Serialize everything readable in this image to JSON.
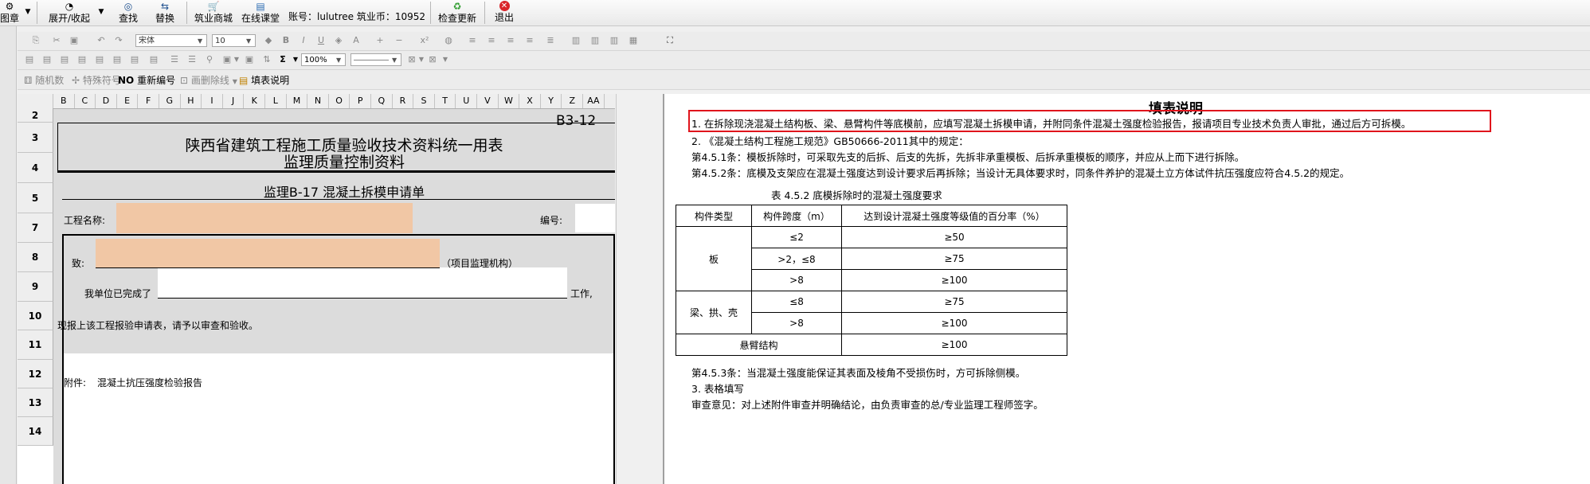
{
  "toolbar": {
    "items": [
      {
        "label": "图章",
        "icon": "stamp-icon"
      },
      {
        "label": "展开/收起",
        "icon": "expand-collapse-icon"
      },
      {
        "label": "查找",
        "icon": "binoculars-icon"
      },
      {
        "label": "替换",
        "icon": "replace-icon"
      },
      {
        "label": "筑业商城",
        "icon": "shopping-cart-icon"
      },
      {
        "label": "在线课堂",
        "icon": "book-icon"
      },
      {
        "label": "检查更新",
        "icon": "update-icon"
      },
      {
        "label": "退出",
        "icon": "exit-icon"
      }
    ],
    "account_text": "账号：lulutree 筑业币：10952"
  },
  "format_bar": {
    "font_name": "宋体",
    "font_size": "10",
    "zoom": "100%"
  },
  "sub_toolbar": {
    "random_number": "随机数",
    "special_symbol": "特殊符号",
    "renumber": "重新编号",
    "delete_line": "画删除线",
    "fill_instructions": "填表说明"
  },
  "sheet": {
    "columns": [
      "B",
      "C",
      "D",
      "E",
      "F",
      "G",
      "H",
      "I",
      "J",
      "K",
      "L",
      "M",
      "N",
      "O",
      "P",
      "Q",
      "R",
      "S",
      "T",
      "U",
      "V",
      "W",
      "X",
      "Y",
      "Z",
      "AA"
    ],
    "rows": [
      "2",
      "3",
      "4",
      "5",
      "7",
      "8",
      "9",
      "10",
      "11",
      "12",
      "13",
      "14"
    ],
    "code": "B3-12",
    "title_line1": "陕西省建筑工程施工质量验收技术资料统一用表",
    "title_line2": "监理质量控制资料",
    "form_title": "监理B-17  混凝土拆模申请单",
    "project_name_label": "工程名称:",
    "number_label": "编号:",
    "to_label": "致:",
    "supervisor_org": "（项目监理机构）",
    "completed_prefix": "我单位已完成了",
    "work_suffix": "工作,",
    "submit_text": "现报上该工程报验申请表，请予以审查和验收。",
    "attachment_label": "附件:",
    "attachment_text": "混凝土抗压强度检验报告"
  },
  "instructions": {
    "heading": "填表说明",
    "line1": "1. 在拆除现浇混凝土结构板、梁、悬臂构件等底模前，应填写混凝土拆模申请，并附同条件混凝土强度检验报告，报请项目专业技术负责人审批，通过后方可拆模。",
    "line2": "2. 《混凝土结构工程施工规范》GB50666-2011其中的规定：",
    "line3": "第4.5.1条：模板拆除时，可采取先支的后拆、后支的先拆，先拆非承重模板、后拆承重模板的顺序，并应从上而下进行拆除。",
    "line4": "第4.5.2条：底模及支架应在混凝土强度达到设计要求后再拆除；当设计无具体要求时，同条件养护的混凝土立方体试件抗压强度应符合4.5.2的规定。",
    "table_caption": "表 4.5.2  底模拆除时的混凝土强度要求",
    "table_headers": [
      "构件类型",
      "构件跨度（m）",
      "达到设计混凝土强度等级值的百分率（%）"
    ],
    "table_rows": [
      {
        "type": "板",
        "span": "≤2",
        "pct": "≥50"
      },
      {
        "type": "",
        "span": ">2，≤8",
        "pct": "≥75"
      },
      {
        "type": "",
        "span": ">8",
        "pct": "≥100"
      },
      {
        "type": "梁、拱、壳",
        "span": "≤8",
        "pct": "≥75"
      },
      {
        "type": "",
        "span": ">8",
        "pct": "≥100"
      },
      {
        "type": "悬臂结构",
        "span": "",
        "pct": "≥100"
      }
    ],
    "line5": "第4.5.3条：当混凝土强度能保证其表面及棱角不受损伤时，方可拆除侧模。",
    "line6": "3. 表格填写",
    "line7": "审查意见：对上述附件审查并明确结论，由负责审查的总/专业监理工程师签字。"
  },
  "colors": {
    "highlight_border": "#e0141c",
    "input_fill": "#f1c7a5",
    "sheet_gray": "#dcdcdc"
  }
}
